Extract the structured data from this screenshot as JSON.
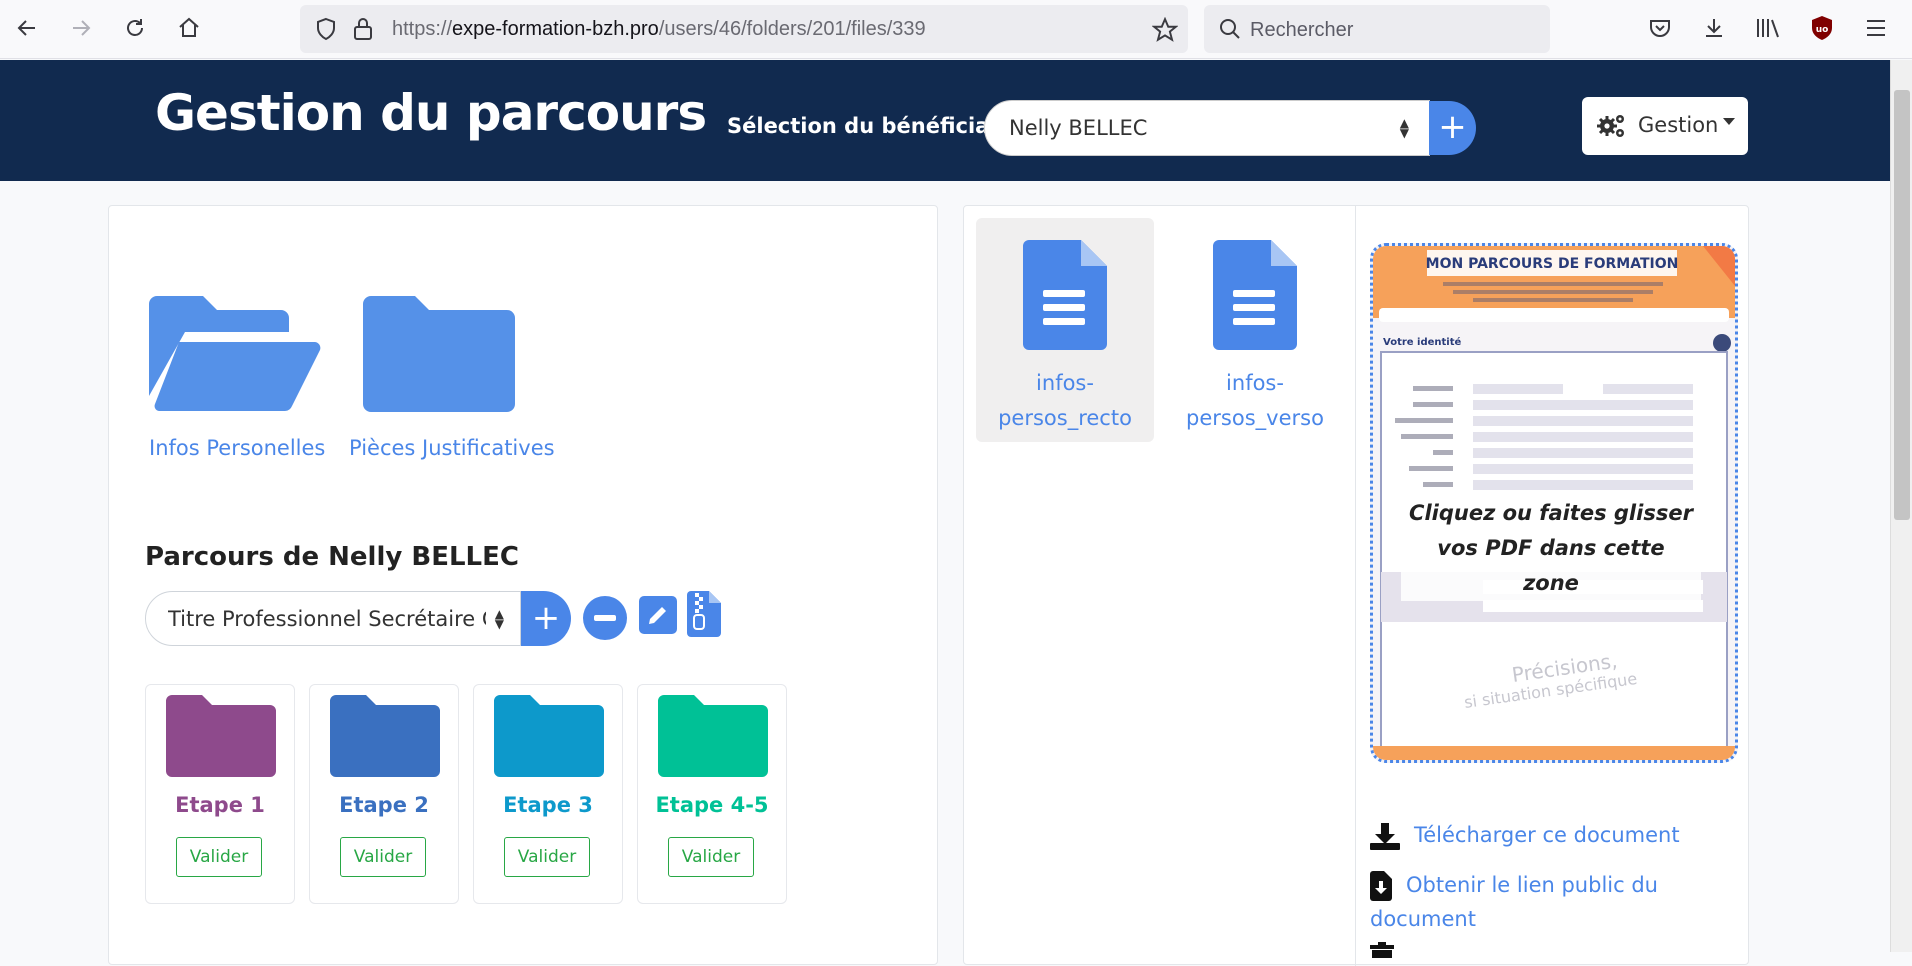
{
  "browser": {
    "url_prefix": "https://",
    "url_domain": "expe-formation-bzh.pro",
    "url_path": "/users/46/folders/201/files/339",
    "search_placeholder": "Rechercher"
  },
  "header": {
    "title": "Gestion du parcours",
    "beneficiary_label": "Sélection du bénéficiaire",
    "beneficiary_value": "Nelly BELLEC",
    "add_symbol": "+",
    "gestion_label": "Gestion"
  },
  "folders": [
    {
      "label": "Infos Personelles",
      "state": "open"
    },
    {
      "label": "Pièces Justificatives",
      "state": "closed"
    }
  ],
  "parcours": {
    "title": "Parcours de Nelly BELLEC",
    "selected": "Titre Professionnel Secrétaire Comptable",
    "add_symbol": "+"
  },
  "etapes": [
    {
      "name": "Etape 1",
      "color": "#8e4a8c",
      "button": "Valider"
    },
    {
      "name": "Etape 2",
      "color": "#3a70c0",
      "button": "Valider"
    },
    {
      "name": "Etape 3",
      "color": "#0d99cb",
      "button": "Valider"
    },
    {
      "name": "Etape 4-5",
      "color": "#00c196",
      "button": "Valider"
    }
  ],
  "files": [
    {
      "label": "infos-persos_recto",
      "active": true
    },
    {
      "label": "infos-persos_verso",
      "active": false
    }
  ],
  "preview": {
    "doc_title": "MON PARCOURS DE FORMATION",
    "section": "Votre identité",
    "drop_text": "Cliquez ou faites glisser vos PDF dans cette zone"
  },
  "actions": {
    "download": "Télécharger ce document",
    "public_link": "Obtenir le lien public du document"
  },
  "colors": {
    "header_bg": "#112a4f",
    "accent": "#4a86e8",
    "success": "#28a745"
  }
}
